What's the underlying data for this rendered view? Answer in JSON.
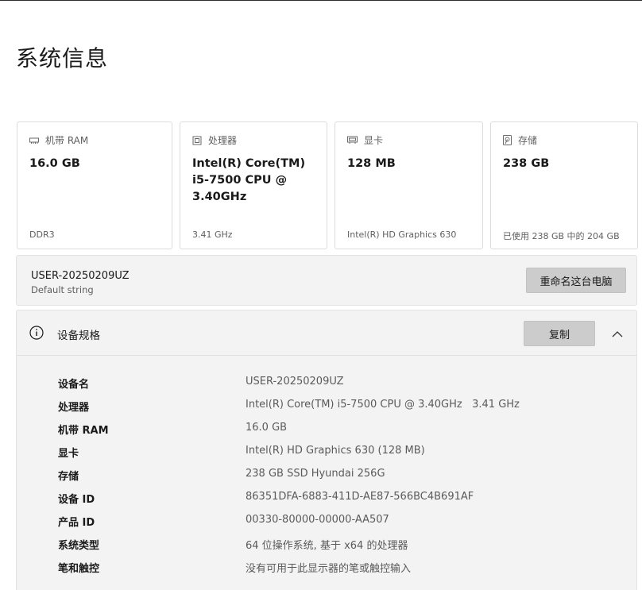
{
  "page": {
    "title": "系统信息"
  },
  "cards": [
    {
      "icon": "ram-icon",
      "label": "机带 RAM",
      "value": "16.0 GB",
      "sub": "DDR3"
    },
    {
      "icon": "cpu-icon",
      "label": "处理器",
      "value": "Intel(R) Core(TM) i5-7500 CPU @ 3.40GHz",
      "sub": "3.41 GHz"
    },
    {
      "icon": "gpu-icon",
      "label": "显卡",
      "value": "128 MB",
      "sub": "Intel(R) HD Graphics 630"
    },
    {
      "icon": "storage-icon",
      "label": "存储",
      "value": "238 GB",
      "sub": "已使用 238 GB 中的 204 GB"
    }
  ],
  "device": {
    "name": "USER-20250209UZ",
    "sub": "Default string",
    "rename_label": "重命名这台电脑"
  },
  "specs": {
    "title": "设备规格",
    "copy_label": "复制",
    "rows": [
      {
        "label": "设备名",
        "value": "USER-20250209UZ"
      },
      {
        "label": "处理器",
        "value": "Intel(R) Core(TM) i5-7500 CPU @ 3.40GHz   3.41 GHz"
      },
      {
        "label": "机带 RAM",
        "value": "16.0 GB"
      },
      {
        "label": "显卡",
        "value": "Intel(R) HD Graphics 630 (128 MB)"
      },
      {
        "label": "存储",
        "value": "238 GB SSD Hyundai 256G"
      },
      {
        "label": "设备 ID",
        "value": "86351DFA-6883-411D-AE87-566BC4B691AF"
      },
      {
        "label": "产品 ID",
        "value": "00330-80000-00000-AA507"
      },
      {
        "label": "系统类型",
        "value": "64 位操作系统, 基于 x64 的处理器"
      },
      {
        "label": "笔和触控",
        "value": "没有可用于此显示器的笔或触控输入"
      }
    ]
  }
}
